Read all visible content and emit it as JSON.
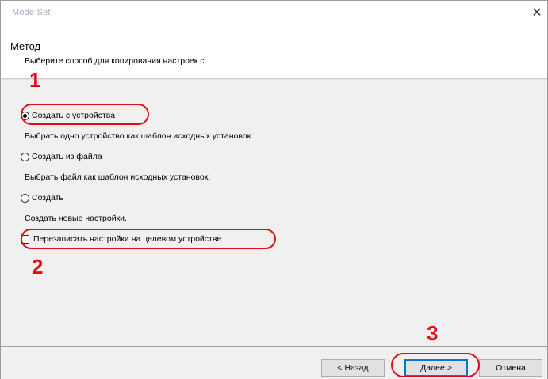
{
  "window": {
    "title": "Mode Set",
    "close_glyph": "✕"
  },
  "header": {
    "title": "Метод",
    "subtitle": "Выберите способ для копирования настроек с"
  },
  "options": [
    {
      "label": "Создать с устройства",
      "checked": true,
      "description": "Выбрать одно устройство как шаблон исходных установок."
    },
    {
      "label": "Создать из файла",
      "checked": false,
      "description": "Выбрать файл как шаблон исходных установок."
    },
    {
      "label": "Создать",
      "checked": false,
      "description": "Создать новые настройки."
    }
  ],
  "overwrite": {
    "label": "Перезаписать настройки на целевом устройстве",
    "checked": false
  },
  "buttons": {
    "back": "< Назад",
    "next": "Далее >",
    "cancel": "Отмена"
  },
  "callouts": [
    "1",
    "2",
    "3"
  ],
  "colors": {
    "callout": "#e40a18",
    "content_bg": "#f0f0f0"
  }
}
